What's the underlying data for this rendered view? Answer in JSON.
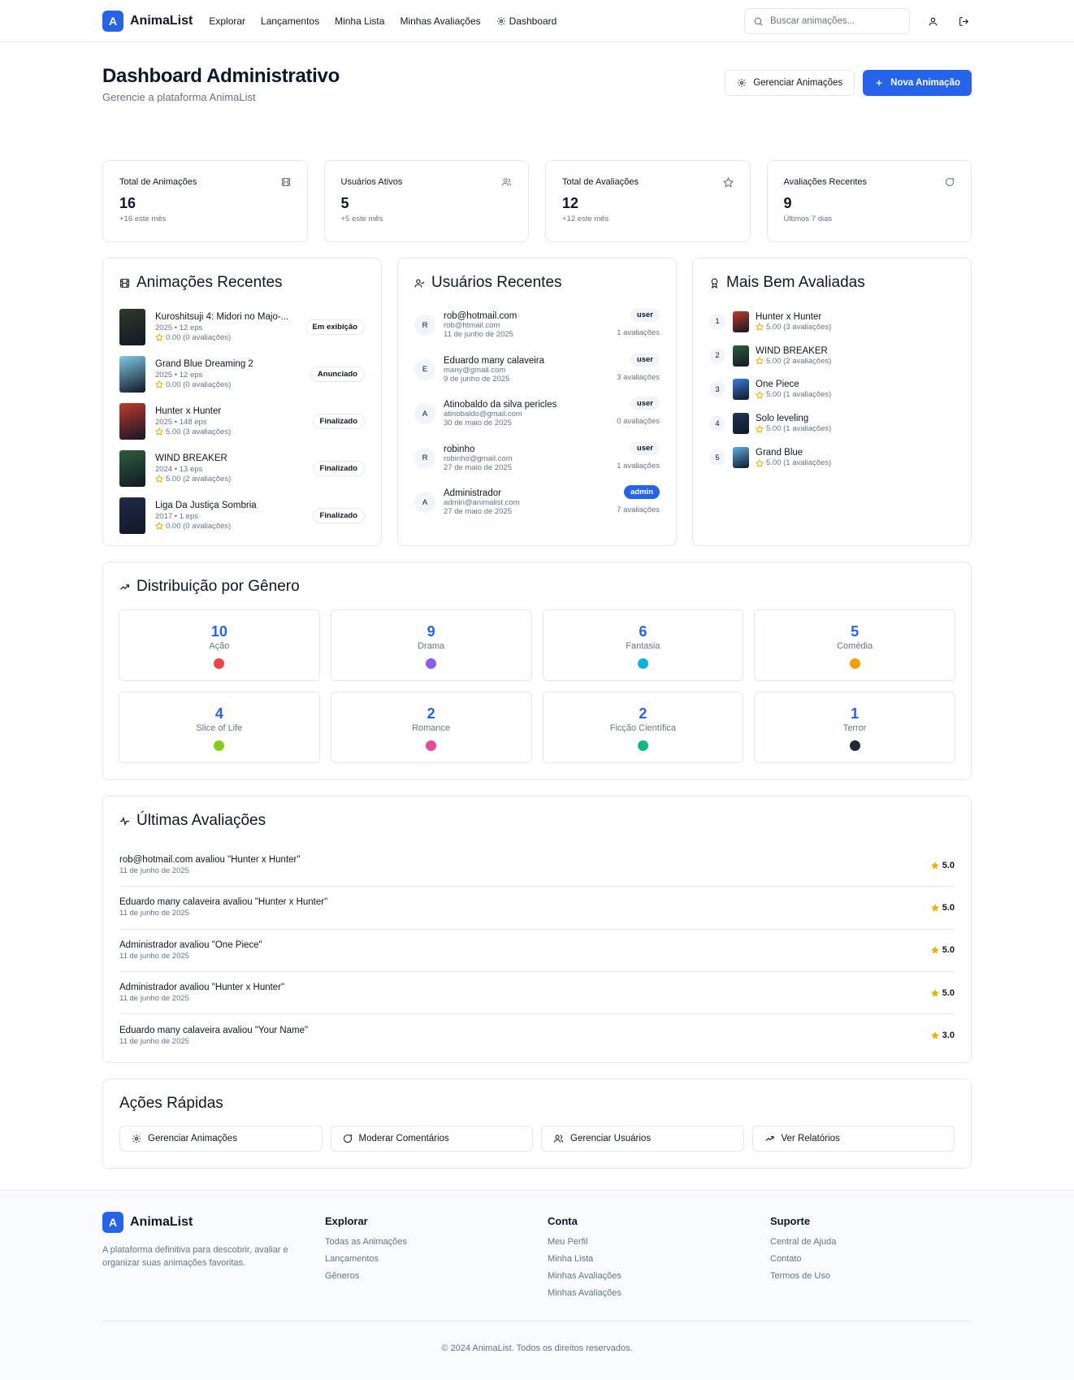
{
  "brand": {
    "logo_letter": "A",
    "name": "AnimaList",
    "accent": "#2563eb"
  },
  "nav": {
    "links": [
      "Explorar",
      "Lançamentos",
      "Minha Lista",
      "Minhas Avaliações",
      "Dashboard"
    ],
    "search_placeholder": "Buscar animações..."
  },
  "page": {
    "title": "Dashboard Administrativo",
    "subtitle": "Gerencie a plataforma AnimaList",
    "manage_button": "Gerenciar Animações",
    "new_button": "Nova Animação"
  },
  "stats": [
    {
      "label": "Total de Animações",
      "value": "16",
      "note": "+16 este mês",
      "icon": "film-icon"
    },
    {
      "label": "Usuários Ativos",
      "value": "5",
      "note": "+5 este mês",
      "icon": "users-icon"
    },
    {
      "label": "Total de Avaliações",
      "value": "12",
      "note": "+12 este mês",
      "icon": "star-icon"
    },
    {
      "label": "Avaliações Recentes",
      "value": "9",
      "note": "Últimos 7 dias",
      "icon": "message-icon"
    }
  ],
  "recent_animations": {
    "title": "Animações Recentes",
    "items": [
      {
        "title": "Kuroshitsuji 4: Midori no Majo-...",
        "meta": "2025 • 12 eps",
        "rating": "0.00 (0 avaliações)",
        "status": "Em exibição",
        "thumb": "#2f3a2a"
      },
      {
        "title": "Grand Blue Dreaming 2",
        "meta": "2025 • 12 eps",
        "rating": "0.00 (0 avaliações)",
        "status": "Anunciado",
        "thumb": "#7ec8e3"
      },
      {
        "title": "Hunter x Hunter",
        "meta": "2025 • 148 eps",
        "rating": "5.00 (3 avaliações)",
        "status": "Finalizado",
        "thumb": "#c0392b"
      },
      {
        "title": "WIND BREAKER",
        "meta": "2024 • 13 eps",
        "rating": "5.00 (2 avaliações)",
        "status": "Finalizado",
        "thumb": "#2e5e3a"
      },
      {
        "title": "Liga Da Justiça Sombria",
        "meta": "2017 • 1 eps",
        "rating": "0.00 (0 avaliações)",
        "status": "Finalizado",
        "thumb": "#1e2a4a"
      }
    ]
  },
  "recent_users": {
    "title": "Usuários Recentes",
    "items": [
      {
        "initial": "R",
        "name": "rob@hotmail.com",
        "email": "rob@htmail.com",
        "date": "11 de junho de 2025",
        "role": "user",
        "count": "1 avaliações"
      },
      {
        "initial": "E",
        "name": "Eduardo many calaveira",
        "email": "many@gmail.com",
        "date": "9 de junho de 2025",
        "role": "user",
        "count": "3 avaliações"
      },
      {
        "initial": "A",
        "name": "Atinobaldo da silva pericles",
        "email": "atinobaldo@gmail.com",
        "date": "30 de maio de 2025",
        "role": "user",
        "count": "0 avaliações"
      },
      {
        "initial": "R",
        "name": "robinho",
        "email": "robinho@gmail.com",
        "date": "27 de maio de 2025",
        "role": "user",
        "count": "1 avaliações"
      },
      {
        "initial": "A",
        "name": "Administrador",
        "email": "admin@animalist.com",
        "date": "27 de maio de 2025",
        "role": "admin",
        "count": "7 avaliações"
      }
    ]
  },
  "top_rated": {
    "title": "Mais Bem Avaliadas",
    "items": [
      {
        "rank": "1",
        "title": "Hunter x Hunter",
        "rating": "5.00 (3 avaliações)",
        "thumb": "#c0392b"
      },
      {
        "rank": "2",
        "title": "WIND BREAKER",
        "rating": "5.00 (2 avaliações)",
        "thumb": "#2e5e3a"
      },
      {
        "rank": "3",
        "title": "One Piece",
        "rating": "5.00 (1 avaliações)",
        "thumb": "#3b7dd8"
      },
      {
        "rank": "4",
        "title": "Solo leveling",
        "rating": "5.00 (1 avaliações)",
        "thumb": "#1d3557"
      },
      {
        "rank": "5",
        "title": "Grand Blue",
        "rating": "5.00 (1 avaliações)",
        "thumb": "#5dade2"
      }
    ]
  },
  "genres": {
    "title": "Distribuição por Gênero",
    "items": [
      {
        "count": "10",
        "name": "Ação",
        "color": "#ef4444"
      },
      {
        "count": "9",
        "name": "Drama",
        "color": "#8b5cf6"
      },
      {
        "count": "6",
        "name": "Fantasia",
        "color": "#06b6d4"
      },
      {
        "count": "5",
        "name": "Comédia",
        "color": "#f59e0b"
      },
      {
        "count": "4",
        "name": "Slice of Life",
        "color": "#84cc16"
      },
      {
        "count": "2",
        "name": "Romance",
        "color": "#ec4899"
      },
      {
        "count": "2",
        "name": "Ficção Científica",
        "color": "#10b981"
      },
      {
        "count": "1",
        "name": "Terror",
        "color": "#1f2937"
      }
    ]
  },
  "latest_reviews": {
    "title": "Últimas Avaliações",
    "items": [
      {
        "text": "rob@hotmail.com avaliou \"Hunter x Hunter\"",
        "date": "11 de junho de 2025",
        "score": "5.0"
      },
      {
        "text": "Eduardo many calaveira avaliou \"Hunter x Hunter\"",
        "date": "11 de junho de 2025",
        "score": "5.0"
      },
      {
        "text": "Administrador avaliou \"One Piece\"",
        "date": "11 de junho de 2025",
        "score": "5.0"
      },
      {
        "text": "Administrador avaliou \"Hunter x Hunter\"",
        "date": "11 de junho de 2025",
        "score": "5.0"
      },
      {
        "text": "Eduardo many calaveira avaliou \"Your Name\"",
        "date": "11 de junho de 2025",
        "score": "3.0"
      }
    ]
  },
  "quick_actions": {
    "title": "Ações Rápidas",
    "items": [
      {
        "label": "Gerenciar Animações",
        "icon": "gear-icon"
      },
      {
        "label": "Moderar Comentários",
        "icon": "message-icon"
      },
      {
        "label": "Gerenciar Usuários",
        "icon": "users-icon"
      },
      {
        "label": "Ver Relatórios",
        "icon": "trending-icon"
      }
    ]
  },
  "footer": {
    "tagline": "A plataforma definitiva para descobrir, avaliar e organizar suas animações favoritas.",
    "columns": [
      {
        "title": "Explorar",
        "links": [
          "Todas as Animações",
          "Lançamentos",
          "Gêneros"
        ]
      },
      {
        "title": "Conta",
        "links": [
          "Meu Perfil",
          "Minha Lista",
          "Minhas Avaliações",
          "Minhas Avaliações"
        ]
      },
      {
        "title": "Suporte",
        "links": [
          "Central de Ajuda",
          "Contato",
          "Termos de Uso"
        ]
      }
    ],
    "copyright": "© 2024 AnimaList. Todos os direitos reservados."
  }
}
